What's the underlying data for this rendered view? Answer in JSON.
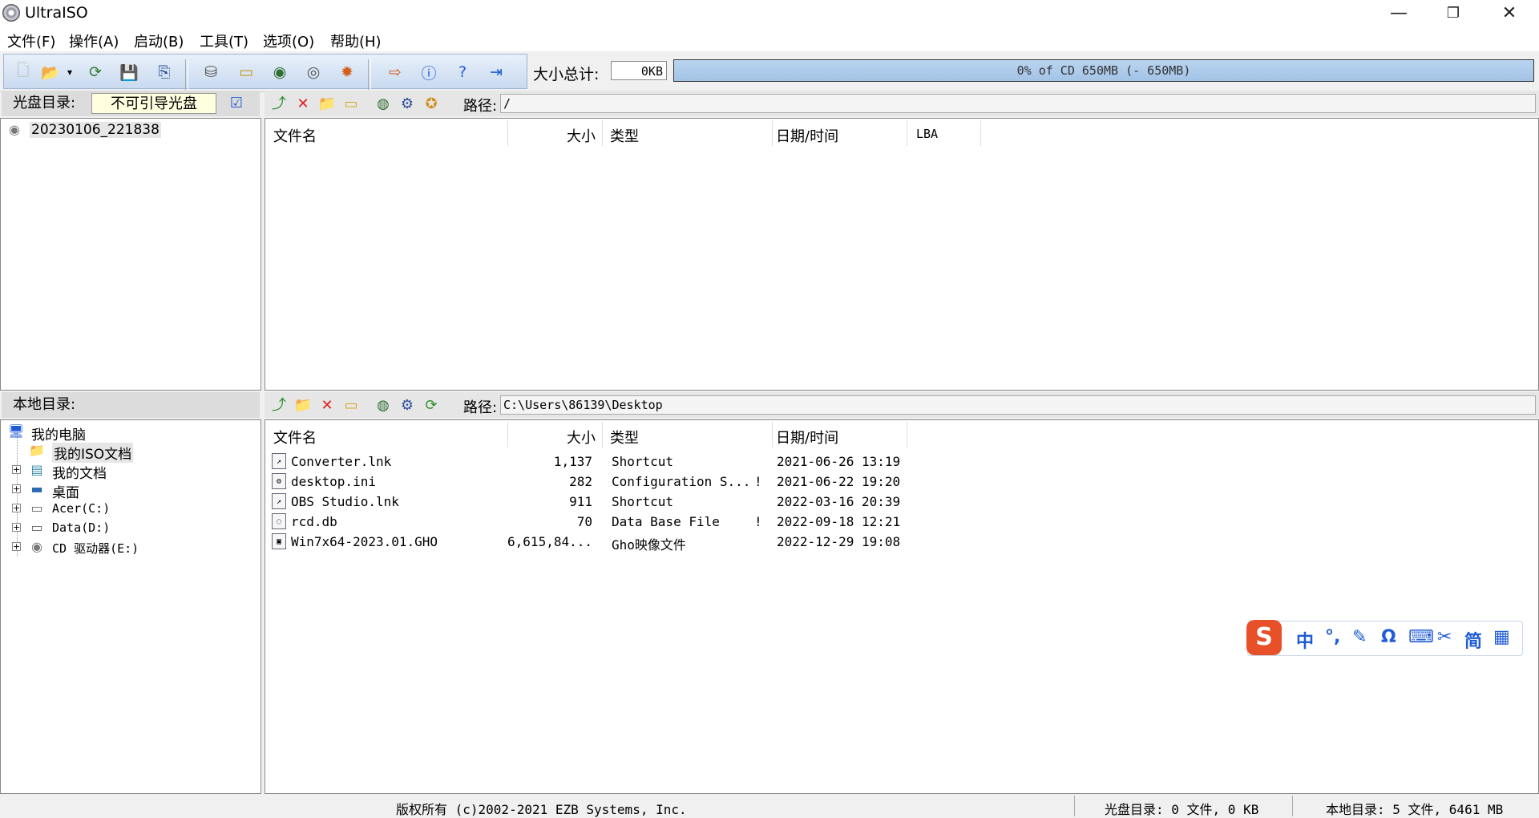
{
  "window": {
    "title": "UltraISO"
  },
  "menu": [
    {
      "label": "文件(F)"
    },
    {
      "label": "操作(A)"
    },
    {
      "label": "启动(B)"
    },
    {
      "label": "工具(T)"
    },
    {
      "label": "选项(O)"
    },
    {
      "label": "帮助(H)"
    }
  ],
  "toolbar": {
    "size_label": "大小总计:",
    "size_value": "0KB",
    "capacity_text": "0% of CD 650MB (- 650MB)",
    "capacity_fraction": 0
  },
  "disc_panel": {
    "label": "光盘目录:",
    "boot_status": "不可引导光盘",
    "tree_root": "20230106_221838",
    "path_label": "路径:",
    "path_value": "/",
    "columns": [
      "文件名",
      "大小",
      "类型",
      "日期/时间",
      "LBA"
    ]
  },
  "local_panel": {
    "label": "本地目录:",
    "path_label": "路径:",
    "path_value": "C:\\Users\\86139\\Desktop",
    "tree": [
      {
        "label": "我的电脑",
        "icon": "computer-icon"
      },
      {
        "label": "我的ISO文档",
        "icon": "iso-folder-icon"
      },
      {
        "label": "我的文档",
        "icon": "documents-icon"
      },
      {
        "label": "桌面",
        "icon": "desktop-icon"
      },
      {
        "label": "Acer(C:)",
        "icon": "drive-icon"
      },
      {
        "label": "Data(D:)",
        "icon": "drive-icon"
      },
      {
        "label": "CD 驱动器(E:)",
        "icon": "cd-drive-icon"
      }
    ],
    "columns": [
      "文件名",
      "大小",
      "类型",
      "日期/时间"
    ],
    "files": [
      {
        "name": "Converter.lnk",
        "size": "1,137",
        "type": "Shortcut",
        "flag": "",
        "date": "2021-06-26 13:19",
        "icon": "shortcut-icon"
      },
      {
        "name": "desktop.ini",
        "size": "282",
        "type": "Configuration S...",
        "flag": "!",
        "date": "2021-06-22 19:20",
        "icon": "settings-file-icon"
      },
      {
        "name": "OBS Studio.lnk",
        "size": "911",
        "type": "Shortcut",
        "flag": "",
        "date": "2022-03-16 20:39",
        "icon": "shortcut-icon"
      },
      {
        "name": "rcd.db",
        "size": "70",
        "type": "Data Base File",
        "flag": "!",
        "date": "2022-09-18 12:21",
        "icon": "db-file-icon"
      },
      {
        "name": "Win7x64-2023.01.GHO",
        "size": "6,615,84...",
        "type": "Gho映像文件",
        "flag": "",
        "date": "2022-12-29 19:08",
        "icon": "gho-file-icon"
      }
    ]
  },
  "status": {
    "copyright": "版权所有 (c)2002-2021 EZB Systems, Inc.",
    "disc_summary": "光盘目录: 0 文件, 0 KB",
    "local_summary": "本地目录: 5 文件, 6461 MB"
  },
  "ime": {
    "items": [
      "中",
      "°,",
      "✎",
      "Ω",
      "⌨",
      "✂",
      "简",
      "▦"
    ]
  }
}
